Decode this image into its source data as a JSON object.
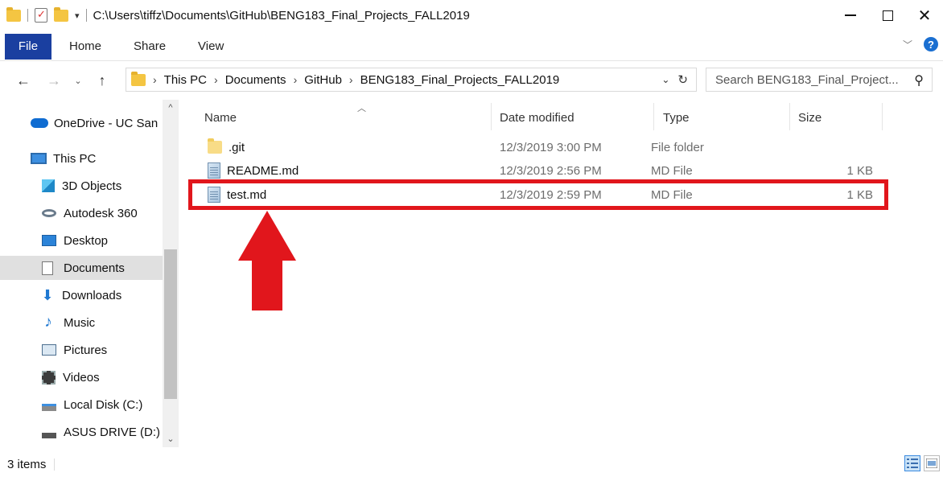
{
  "window": {
    "title": "C:\\Users\\tiffz\\Documents\\GitHub\\BENG183_Final_Projects_FALL2019"
  },
  "ribbon": {
    "tabs": [
      {
        "label": "File"
      },
      {
        "label": "Home"
      },
      {
        "label": "Share"
      },
      {
        "label": "View"
      }
    ],
    "help_label": "?"
  },
  "address": {
    "breadcrumbs": [
      "This PC",
      "Documents",
      "GitHub",
      "BENG183_Final_Projects_FALL2019"
    ]
  },
  "search": {
    "placeholder": "Search BENG183_Final_Project..."
  },
  "sidebar": {
    "items": [
      {
        "label": "OneDrive - UC San Diego",
        "icon": "cloud-icon"
      },
      {
        "label": "This PC",
        "icon": "computer-icon"
      },
      {
        "label": "3D Objects",
        "icon": "cube-icon"
      },
      {
        "label": "Autodesk 360",
        "icon": "autodesk-icon"
      },
      {
        "label": "Desktop",
        "icon": "desktop-icon"
      },
      {
        "label": "Documents",
        "icon": "document-icon",
        "selected": true
      },
      {
        "label": "Downloads",
        "icon": "download-icon"
      },
      {
        "label": "Music",
        "icon": "music-icon"
      },
      {
        "label": "Pictures",
        "icon": "pictures-icon"
      },
      {
        "label": "Videos",
        "icon": "videos-icon"
      },
      {
        "label": "Local Disk (C:)",
        "icon": "drive-icon"
      },
      {
        "label": "ASUS DRIVE (D:)",
        "icon": "drive-icon"
      }
    ]
  },
  "columns": {
    "name": "Name",
    "date": "Date modified",
    "type": "Type",
    "size": "Size"
  },
  "files": [
    {
      "name": ".git",
      "date": "12/3/2019 3:00 PM",
      "type": "File folder",
      "size": "",
      "icon": "folder-icon"
    },
    {
      "name": "README.md",
      "date": "12/3/2019 2:56 PM",
      "type": "MD File",
      "size": "1 KB",
      "icon": "file-icon"
    },
    {
      "name": "test.md",
      "date": "12/3/2019 2:59 PM",
      "type": "MD File",
      "size": "1 KB",
      "icon": "file-icon"
    }
  ],
  "status": {
    "count": "3 items"
  },
  "colors": {
    "file_tab": "#1a3fa0",
    "highlight": "#e1161c",
    "selected_sidebar": "#e0e0e0"
  }
}
